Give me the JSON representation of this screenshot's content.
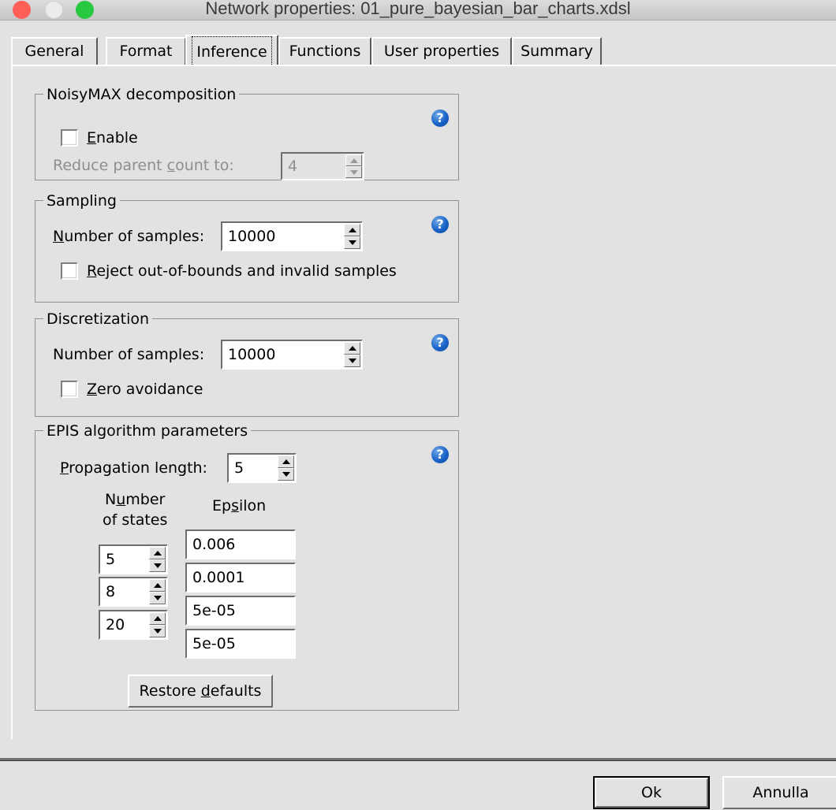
{
  "window": {
    "title": "Network properties: 01_pure_bayesian_bar_charts.xdsl",
    "controls": {
      "close": "close-button",
      "minimize": "minimize-button",
      "zoom": "zoom-button"
    }
  },
  "tabs": [
    {
      "label": "General",
      "selected": false
    },
    {
      "label": "Format",
      "selected": false
    },
    {
      "label": "Inference",
      "selected": true
    },
    {
      "label": "Functions",
      "selected": false
    },
    {
      "label": "User properties",
      "selected": false
    },
    {
      "label": "Summary",
      "selected": false
    }
  ],
  "help_glyph": "?",
  "groups": {
    "noisymax": {
      "legend": "NoisyMAX decomposition",
      "enable_checkbox": {
        "label": "Enable",
        "checked": false
      },
      "reduce_parent": {
        "label": "Reduce parent count to:",
        "value": "4",
        "disabled": true
      }
    },
    "sampling": {
      "legend": "Sampling",
      "number_of_samples": {
        "label": "Number of samples:",
        "value": "10000"
      },
      "reject_checkbox": {
        "label": "Reject out-of-bounds and invalid samples",
        "checked": false
      }
    },
    "discretization": {
      "legend": "Discretization",
      "number_of_samples": {
        "label": "Number of samples:",
        "value": "10000"
      },
      "zero_avoidance_checkbox": {
        "label": "Zero avoidance",
        "checked": false
      }
    },
    "epis": {
      "legend": "EPIS algorithm parameters",
      "propagation_length": {
        "label": "Propagation length:",
        "value": "5"
      },
      "column_headers": {
        "number_of_states_line1": "Number",
        "number_of_states_line2": "of states",
        "epsilon": "Epsilon"
      },
      "rows": [
        {
          "states": "5",
          "epsilon": "0.006"
        },
        {
          "states": "8",
          "epsilon": "0.0001"
        },
        {
          "states": "20",
          "epsilon": "5e-05"
        },
        {
          "states": "",
          "epsilon": "5e-05"
        }
      ],
      "restore_defaults_button": "Restore defaults"
    }
  },
  "footer": {
    "ok_button": "Ok",
    "cancel_button": "Annulla"
  }
}
